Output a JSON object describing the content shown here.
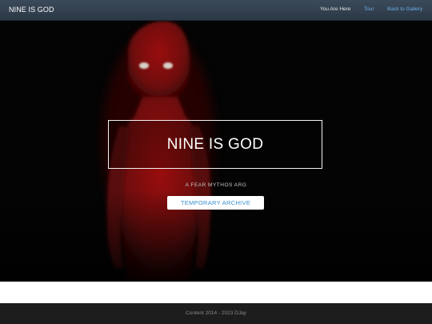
{
  "navbar": {
    "brand": "NINE IS GOD",
    "links": [
      {
        "label": "You Are Here"
      },
      {
        "label": "Tour"
      },
      {
        "label": "Back to Gallery"
      }
    ]
  },
  "hero": {
    "title": "NINE IS GOD",
    "subtitle": "A FEAR MYTHOS ARG",
    "button_label": "TEMPORARY ARCHIVE",
    "figure_icon": "red-humanoid-figure-image"
  },
  "footer": {
    "text": "Content 2014 - 2023 DJay"
  },
  "colors": {
    "navbar_bg": "#2f3d4b",
    "link": "#6fb0e6",
    "figure_red": "#8b0d0d",
    "hero_bg": "#050404",
    "footer_bg": "#1d1d1d"
  }
}
